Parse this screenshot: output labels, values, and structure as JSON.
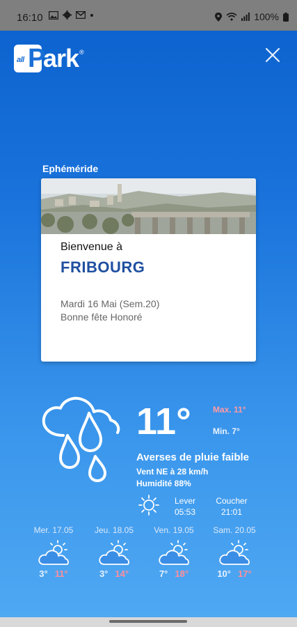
{
  "status_bar": {
    "time": "16:10",
    "battery": "100%"
  },
  "app": {
    "logo_prefix": "all",
    "logo_p": "P",
    "logo_rest": "ark",
    "logo_mark": "®"
  },
  "ephemeride": {
    "section_title": "Ephéméride",
    "welcome": "Bienvenue à",
    "city": "FRIBOURG",
    "date": "Mardi 16 Mai (Sem.20)",
    "fete": "Bonne fête Honoré"
  },
  "weather": {
    "temperature": "11°",
    "max": "Max. 11°",
    "min": "Min. 7°",
    "condition": "Averses de pluie faible",
    "wind": "Vent NE à 28 km/h",
    "humidity": "Humidité 88%",
    "sunrise_label": "Lever",
    "sunrise_time": "05:53",
    "sunset_label": "Coucher",
    "sunset_time": "21:01"
  },
  "forecast": [
    {
      "day": "Mer. 17.05",
      "min": "3°",
      "max": "11°",
      "icon": "partly-cloudy-icon"
    },
    {
      "day": "Jeu. 18.05",
      "min": "3°",
      "max": "14°",
      "icon": "partly-cloudy-icon"
    },
    {
      "day": "Ven. 19.05",
      "min": "7°",
      "max": "18°",
      "icon": "partly-cloudy-icon"
    },
    {
      "day": "Sam. 20.05",
      "min": "10°",
      "max": "17°",
      "icon": "partly-cloudy-icon"
    }
  ],
  "colors": {
    "accent_blue": "#1a6fd6",
    "city_text": "#1f4fa0",
    "max_temp": "#ff8f9c"
  }
}
